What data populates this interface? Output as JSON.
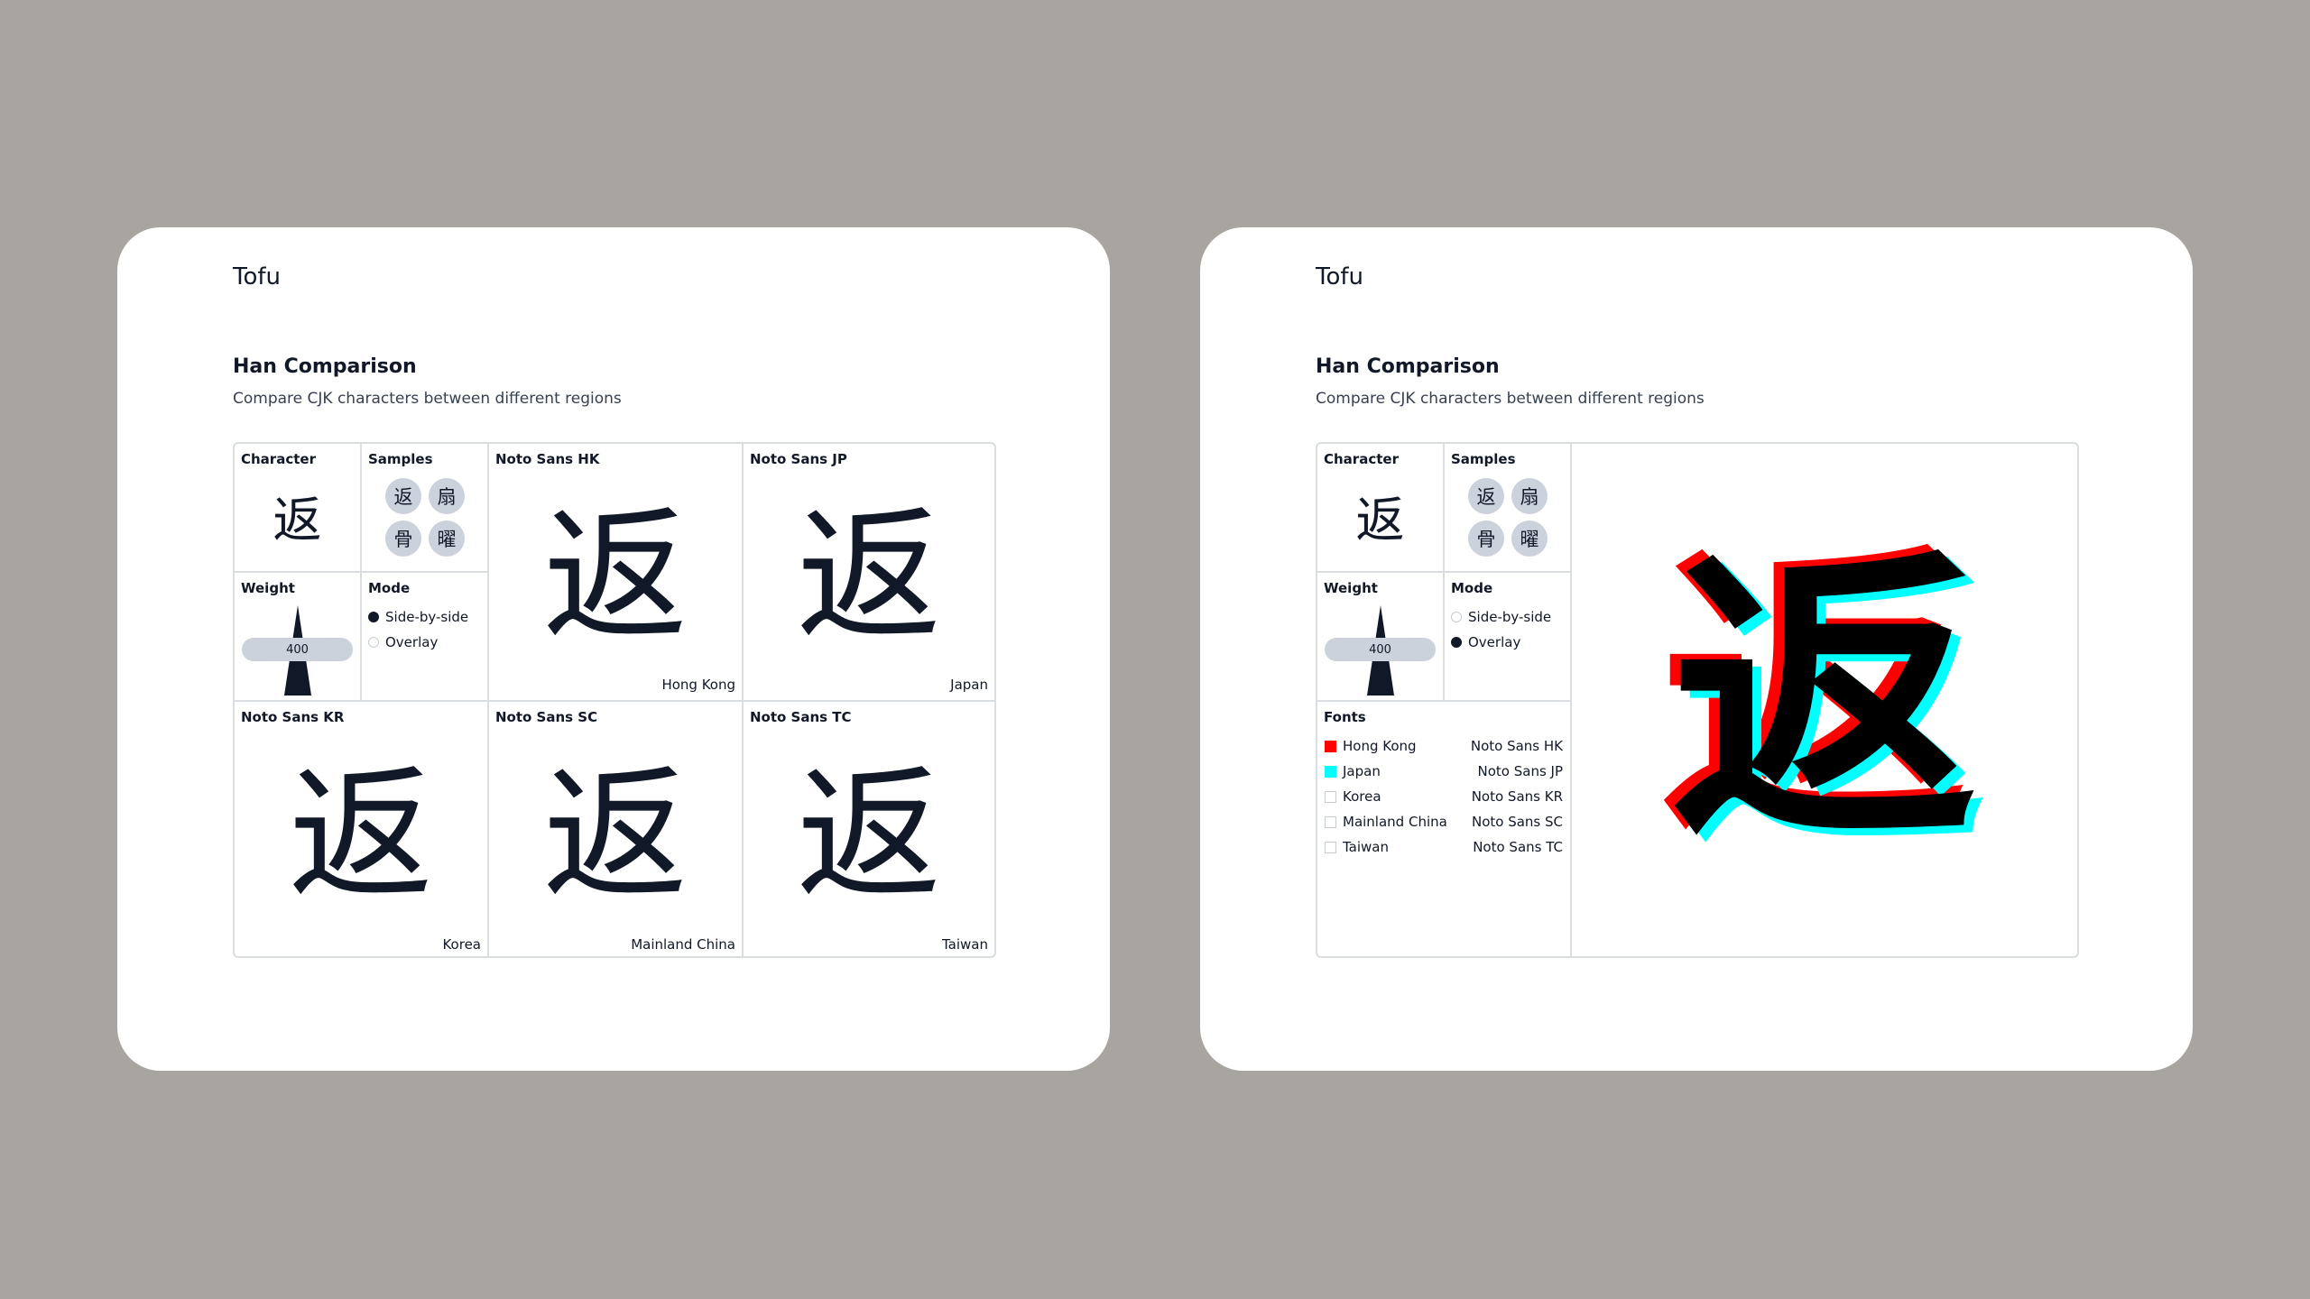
{
  "app_name": "Tofu",
  "page": {
    "title": "Han Comparison",
    "subtitle": "Compare CJK characters between different regions"
  },
  "labels": {
    "character": "Character",
    "samples": "Samples",
    "weight": "Weight",
    "mode": "Mode",
    "fonts": "Fonts"
  },
  "character": "返",
  "samples": [
    "返",
    "扇",
    "骨",
    "曜"
  ],
  "weight": {
    "value": "400"
  },
  "mode_options": [
    "Side-by-side",
    "Overlay"
  ],
  "views": [
    {
      "selected_mode": "Side-by-side",
      "fonts": [
        {
          "font": "Noto Sans HK",
          "region": "Hong Kong"
        },
        {
          "font": "Noto Sans JP",
          "region": "Japan"
        },
        {
          "font": "Noto Sans KR",
          "region": "Korea"
        },
        {
          "font": "Noto Sans SC",
          "region": "Mainland China"
        },
        {
          "font": "Noto Sans TC",
          "region": "Taiwan"
        }
      ]
    },
    {
      "selected_mode": "Overlay",
      "fonts": [
        {
          "region": "Hong Kong",
          "font": "Noto Sans HK",
          "enabled": true,
          "color": "#ff0000"
        },
        {
          "region": "Japan",
          "font": "Noto Sans JP",
          "enabled": true,
          "color": "#00ffff"
        },
        {
          "region": "Korea",
          "font": "Noto Sans KR",
          "enabled": false,
          "color": "#ffffff"
        },
        {
          "region": "Mainland China",
          "font": "Noto Sans SC",
          "enabled": false,
          "color": "#ffffff"
        },
        {
          "region": "Taiwan",
          "font": "Noto Sans TC",
          "enabled": false,
          "color": "#ffffff"
        }
      ],
      "overlay_top_color": "#000000"
    }
  ]
}
